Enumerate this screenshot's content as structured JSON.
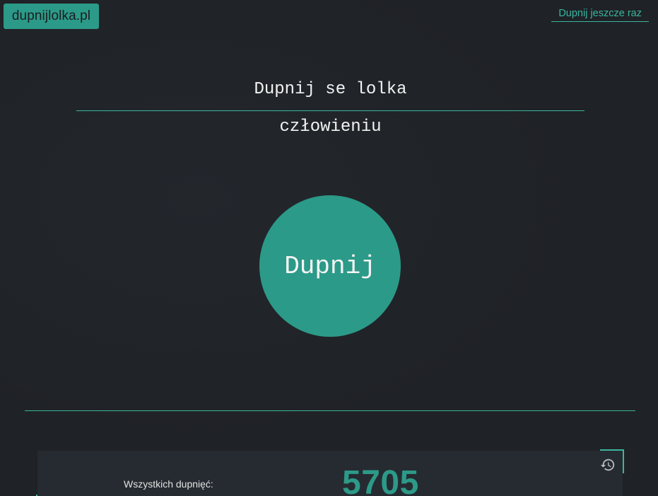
{
  "header": {
    "logo_text": "dupnijlolka.pl",
    "again_link": "Dupnij jeszcze raz"
  },
  "main": {
    "headline": "Dupnij se lolka",
    "subline": "człowieniu",
    "button_label": "Dupnij"
  },
  "stats": {
    "label": "Wszystkich dupnięć:",
    "count": "5705",
    "history_icon": "history-icon"
  },
  "colors": {
    "accent": "#2c9a88",
    "accent_light": "#3bb59f",
    "background": "#1f2226",
    "panel": "#262b31"
  }
}
